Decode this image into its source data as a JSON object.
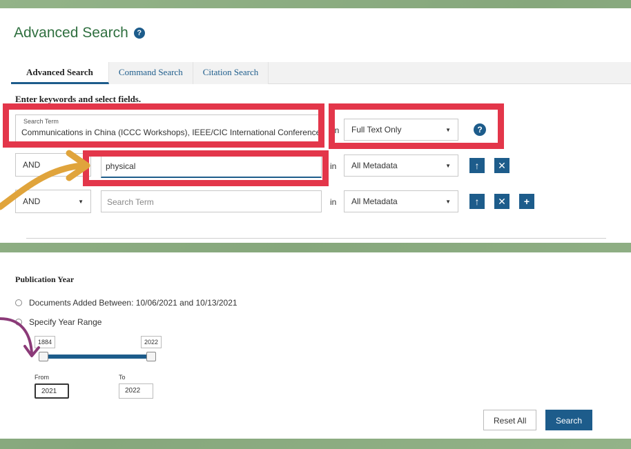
{
  "page": {
    "title": "Advanced Search",
    "help_glyph": "?"
  },
  "tabs": [
    {
      "label": "Advanced Search",
      "active": true
    },
    {
      "label": "Command Search",
      "active": false
    },
    {
      "label": "Citation Search",
      "active": false
    }
  ],
  "form": {
    "instruction": "Enter keywords and select fields.",
    "rows": [
      {
        "operator": "",
        "term_label": "Search Term",
        "term_value": "Communications in China (ICCC Workshops), IEEE/CIC International Conference on",
        "in_label": "in",
        "field": "Full Text Only"
      },
      {
        "operator": "AND",
        "term_value": "physical",
        "in_label": "in",
        "field": "All Metadata"
      },
      {
        "operator": "AND",
        "term_placeholder": "Search Term",
        "in_label": "in",
        "field": "All Metadata"
      }
    ]
  },
  "publication_year": {
    "title": "Publication Year",
    "option_added": "Documents Added Between: 10/06/2021 and 10/13/2021",
    "option_range": "Specify Year Range",
    "slider_min_label": "1884",
    "slider_max_label": "2022",
    "from_label": "From",
    "to_label": "To",
    "from_value": "2021",
    "to_value": "2022"
  },
  "actions": {
    "reset_label": "Reset All",
    "search_label": "Search"
  },
  "colors": {
    "brand_blue": "#1d5c8b",
    "highlight_red": "#e3364a",
    "arrow_orange": "#e0a43c",
    "arrow_purple": "#8b3a78"
  },
  "icons": {
    "up": "arrow-up-icon",
    "remove": "close-icon",
    "add": "plus-icon",
    "help": "help-icon"
  }
}
